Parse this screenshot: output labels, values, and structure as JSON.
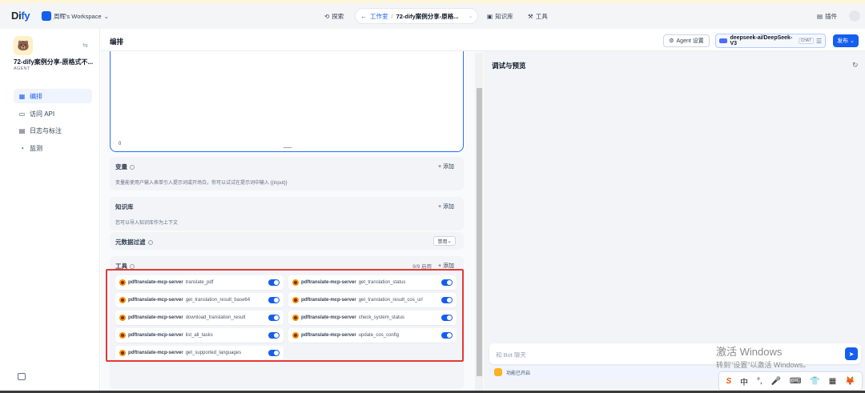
{
  "topbar": {
    "logo_main": "Di",
    "logo_accent": "fy",
    "workspace": "周晖's Workspace",
    "explore": "探索",
    "studio": "工作室",
    "app_name": "72-dify案例分享-原格...",
    "knowledge": "知识库",
    "tools": "工具",
    "plugins": "插件"
  },
  "sidebar": {
    "app_name": "72-dify案例分享-原格式不...",
    "app_type": "AGENT",
    "items": [
      {
        "label": "编排",
        "icon": "layout-icon",
        "active": true
      },
      {
        "label": "访问 API",
        "icon": "terminal-icon",
        "active": false
      },
      {
        "label": "日志与标注",
        "icon": "file-text-icon",
        "active": false
      },
      {
        "label": "监测",
        "icon": "monitor-icon",
        "active": false
      }
    ]
  },
  "header": {
    "title": "编排",
    "agent_settings": "Agent 设置",
    "model": "deepseek-ai/DeepSeek-V3",
    "model_badge": "CHAT",
    "publish": "发布"
  },
  "prompt": {
    "char_count": "0"
  },
  "variables": {
    "title": "变量",
    "add": "+ 添加",
    "desc": "变量能使用户输入表单引入提示词或开场白，你可以试试在提示词中输入 {{input}}"
  },
  "knowledge": {
    "title": "知识库",
    "add": "+ 添加",
    "desc": "您可以导入知识库作为上下文",
    "metadata_filter": "元数据过滤",
    "metadata_value": "禁用"
  },
  "tools": {
    "title": "工具",
    "count": "9/9 启用",
    "add": "+ 添加",
    "items": [
      {
        "provider": "pdftranslate-mcp-server",
        "name": "translate_pdf",
        "enabled": true
      },
      {
        "provider": "pdftranslate-mcp-server",
        "name": "get_translation_status",
        "enabled": true
      },
      {
        "provider": "pdftranslate-mcp-server",
        "name": "get_translation_result_base64",
        "enabled": true
      },
      {
        "provider": "pdftranslate-mcp-server",
        "name": "get_translation_result_cos_url",
        "enabled": true
      },
      {
        "provider": "pdftranslate-mcp-server",
        "name": "download_translation_result",
        "enabled": true
      },
      {
        "provider": "pdftranslate-mcp-server",
        "name": "check_system_status",
        "enabled": true
      },
      {
        "provider": "pdftranslate-mcp-server",
        "name": "list_all_tasks",
        "enabled": true
      },
      {
        "provider": "pdftranslate-mcp-server",
        "name": "update_cos_config",
        "enabled": true
      },
      {
        "provider": "pdftranslate-mcp-server",
        "name": "get_supported_languages",
        "enabled": true
      }
    ]
  },
  "preview": {
    "title": "调试与预览",
    "input_placeholder": "和 Bot 聊天",
    "feature_status": "功能已开启"
  },
  "watermark": {
    "line1": "激活 Windows",
    "line2": "转到\"设置\"以激活 Windows。"
  },
  "ime": {
    "items": [
      "S",
      "中",
      "°,",
      "🎤",
      "⌨",
      "👕",
      "▦",
      "🦊"
    ]
  }
}
